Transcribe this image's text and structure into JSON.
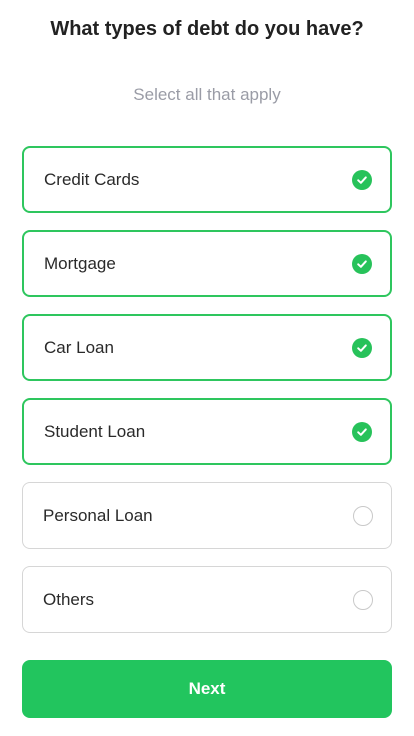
{
  "header": {
    "title": "What types of debt do you have?",
    "subtitle": "Select all that apply"
  },
  "options": [
    {
      "label": "Credit Cards",
      "selected": true,
      "icon": "check-circle-icon"
    },
    {
      "label": "Mortgage",
      "selected": true,
      "icon": "check-circle-icon"
    },
    {
      "label": "Car Loan",
      "selected": true,
      "icon": "check-circle-icon"
    },
    {
      "label": "Student Loan",
      "selected": true,
      "icon": "check-circle-icon"
    },
    {
      "label": "Personal Loan",
      "selected": false,
      "icon": "empty-circle-icon"
    },
    {
      "label": "Others",
      "selected": false,
      "icon": "empty-circle-icon"
    }
  ],
  "footer": {
    "next_label": "Next"
  },
  "colors": {
    "accent": "#22c55e",
    "border_unselected": "#d6d6d6",
    "subtitle": "#9a9ca6"
  }
}
